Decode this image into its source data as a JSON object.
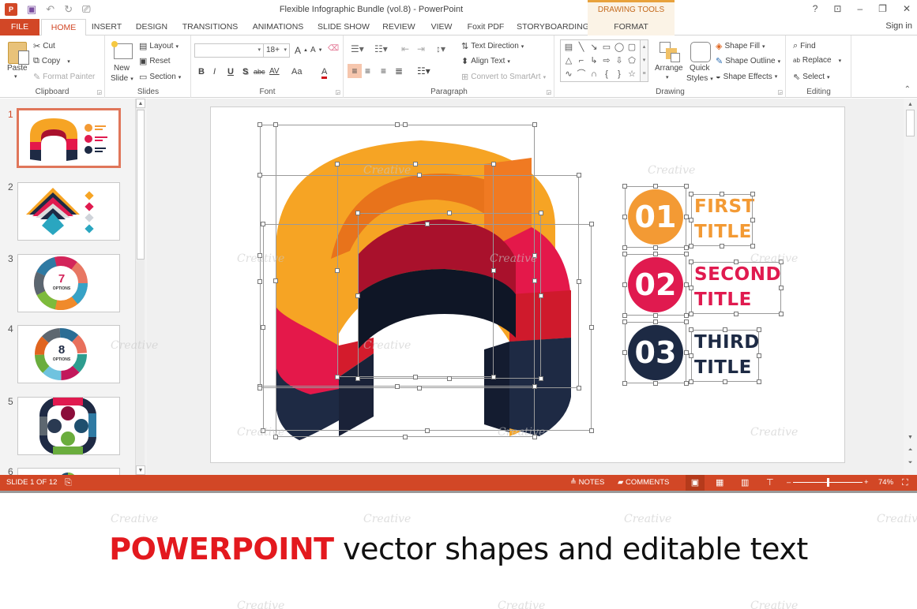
{
  "app": {
    "window_title": "Flexible Infographic Bundle (vol.8) - PowerPoint",
    "contextual_header": "DRAWING TOOLS",
    "sign_in": "Sign in",
    "icons": {
      "logo": "P",
      "save": "💾",
      "undo": "↶",
      "redo": "↻",
      "presenter": "⎚",
      "help": "?",
      "ribbon_display": "⊡",
      "minimize": "–",
      "restore": "❐",
      "close": "✕"
    }
  },
  "tabs": [
    {
      "label": "FILE"
    },
    {
      "label": "HOME"
    },
    {
      "label": "INSERT"
    },
    {
      "label": "DESIGN"
    },
    {
      "label": "TRANSITIONS"
    },
    {
      "label": "ANIMATIONS"
    },
    {
      "label": "SLIDE SHOW"
    },
    {
      "label": "REVIEW"
    },
    {
      "label": "VIEW"
    },
    {
      "label": "Foxit PDF"
    },
    {
      "label": "STORYBOARDING"
    },
    {
      "label": "FORMAT"
    }
  ],
  "active_tab": "HOME",
  "ribbon": {
    "clipboard": {
      "label": "Clipboard",
      "paste": "Paste",
      "cut": "Cut",
      "copy": "Copy",
      "format_painter": "Format Painter"
    },
    "slides": {
      "label": "Slides",
      "new_slide_1": "New",
      "new_slide_2": "Slide",
      "layout": "Layout",
      "reset": "Reset",
      "section": "Section"
    },
    "font": {
      "label": "Font",
      "font_name": "",
      "font_size": "18+",
      "grow": "A",
      "shrink": "A",
      "bold": "B",
      "italic": "I",
      "underline": "U",
      "shadow": "S",
      "strike": "abc",
      "spacing": "AV",
      "case": "Aa",
      "color": "A"
    },
    "paragraph": {
      "label": "Paragraph",
      "text_direction": "Text Direction",
      "align_text": "Align Text",
      "convert_smartart": "Convert to SmartArt"
    },
    "drawing": {
      "label": "Drawing",
      "arrange": "Arrange",
      "quick_styles_1": "Quick",
      "quick_styles_2": "Styles",
      "shape_fill": "Shape Fill",
      "shape_outline": "Shape Outline",
      "shape_effects": "Shape Effects"
    },
    "editing": {
      "label": "Editing",
      "find": "Find",
      "replace": "Replace",
      "select": "Select"
    }
  },
  "slides_panel": {
    "thumbnails": [
      {
        "number": "1",
        "selected": true
      },
      {
        "number": "2",
        "selected": false
      },
      {
        "number": "3",
        "selected": false,
        "center_text": "7",
        "sub_text": "OPTIONS"
      },
      {
        "number": "4",
        "selected": false,
        "center_text": "8",
        "sub_text": "OPTIONS"
      },
      {
        "number": "5",
        "selected": false
      },
      {
        "number": "6",
        "selected": false
      }
    ]
  },
  "slide": {
    "items": [
      {
        "number": "01",
        "title_1": "FIRST",
        "title_2": "TITLE",
        "color": "#f39a34"
      },
      {
        "number": "02",
        "title_1": "SECOND",
        "title_2": "TITLE",
        "color": "#e01a4f"
      },
      {
        "number": "03",
        "title_1": "THIRD",
        "title_2": "TITLE",
        "color": "#1d2a44"
      }
    ],
    "arch_colors": {
      "top": "#f6a424",
      "inner_top": "#e8731b",
      "red": "#e4184a",
      "dark_red": "#a9112c",
      "navy": "#1e2a44",
      "dark": "#0f1626"
    }
  },
  "statusbar": {
    "slide_info": "SLIDE 1 OF 12",
    "notes": "NOTES",
    "comments": "COMMENTS",
    "zoom": "74%",
    "zoom_value": 0.5
  },
  "caption": {
    "strong": "POWERPOINT",
    "rest": " vector shapes and editable text"
  },
  "watermark": "Creative"
}
